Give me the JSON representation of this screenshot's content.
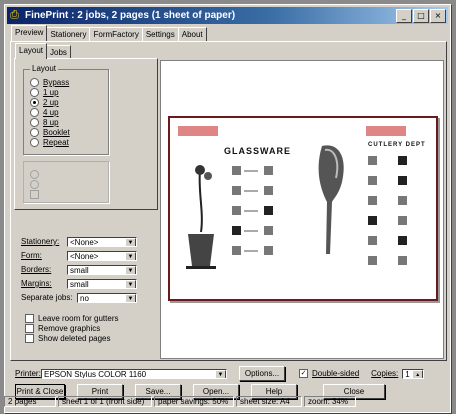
{
  "window": {
    "title": "FinePrint : 2 jobs, 2 pages (1 sheet of paper)",
    "app_icon": "printer-icon",
    "title_color": "#0a246a"
  },
  "tabs": [
    "Preview",
    "Stationery",
    "FormFactory",
    "Settings",
    "About"
  ],
  "subtabs": [
    "Layout",
    "Jobs"
  ],
  "layout_group": {
    "title": "Layout",
    "options": [
      "Bypass",
      "1 up",
      "2 up",
      "4 up",
      "8 up",
      "Booklet",
      "Repeat"
    ],
    "selected": "2 up"
  },
  "form": {
    "stationery": {
      "label": "Stationery:",
      "value": "<None>"
    },
    "form": {
      "label": "Form:",
      "value": "<None>"
    },
    "borders": {
      "label": "Borders:",
      "value": "small"
    },
    "margins": {
      "label": "Margins:",
      "value": "small"
    },
    "separate_jobs": {
      "label": "Separate jobs:",
      "value": "no"
    }
  },
  "checks": [
    {
      "label": "Leave room for gutters",
      "checked": false
    },
    {
      "label": "Remove graphics",
      "checked": false
    },
    {
      "label": "Show deleted pages",
      "checked": false
    }
  ],
  "preview": {
    "left_page_title": "GLASSWARE",
    "right_page_title": "CUTLERY DEPT"
  },
  "printer": {
    "label": "Printer:",
    "value": "EPSON Stylus COLOR 1160",
    "options_label": "Options...",
    "double_sided_label": "Double-sided",
    "double_sided_checked": true,
    "copies_label": "Copies:",
    "copies_value": "1"
  },
  "buttons": [
    "Print & Close",
    "Print",
    "Save...",
    "Open...",
    "Help",
    "Close"
  ],
  "status": [
    "2 pages",
    "sheet 1 of 1 (front side)",
    "paper savings: 50%",
    "sheet size: A4",
    "zoom: 34%"
  ]
}
